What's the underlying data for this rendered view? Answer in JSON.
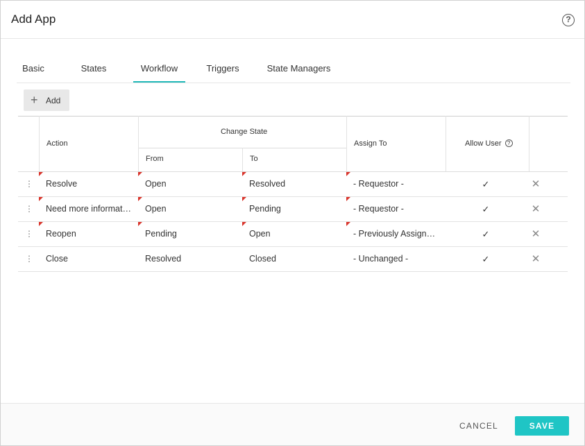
{
  "dialog": {
    "title": "Add App",
    "help_icon": "question-circle-icon",
    "help_glyph": "?"
  },
  "tabs": [
    {
      "label": "Basic",
      "active": false
    },
    {
      "label": "States",
      "active": false
    },
    {
      "label": "Workflow",
      "active": true
    },
    {
      "label": "Triggers",
      "active": false
    },
    {
      "label": "State Managers",
      "active": false
    }
  ],
  "toolbar": {
    "add_label": "Add",
    "add_icon": "plus-icon"
  },
  "table": {
    "headers": {
      "action": "Action",
      "change_state": "Change State",
      "from": "From",
      "to": "To",
      "assign_to": "Assign To",
      "allow_user": "Allow User"
    },
    "rows": [
      {
        "action": "Resolve",
        "from": "Open",
        "to": "Resolved",
        "assign_to": "- Requestor -",
        "allow_user": true
      },
      {
        "action": "Need more information",
        "from": "Open",
        "to": "Pending",
        "assign_to": "- Requestor -",
        "allow_user": true
      },
      {
        "action": "Reopen",
        "from": "Pending",
        "to": "Open",
        "assign_to": "- Previously Assigned -",
        "allow_user": true
      },
      {
        "action": "Close",
        "from": "Resolved",
        "to": "Closed",
        "assign_to": "- Unchanged -",
        "allow_user": true
      }
    ]
  },
  "footer": {
    "cancel_label": "CANCEL",
    "save_label": "SAVE"
  },
  "colors": {
    "accent": "#1fc5c5",
    "tab_underline": "#1fb8b8",
    "required_flag": "#d9342b"
  }
}
